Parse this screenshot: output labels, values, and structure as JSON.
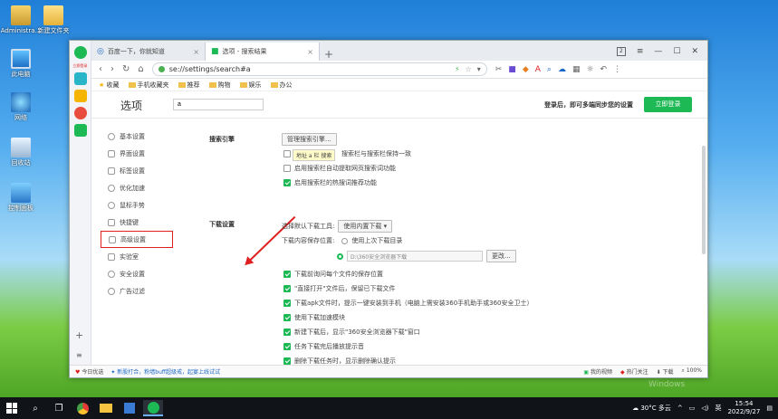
{
  "desktop": {
    "icons": [
      {
        "label": "Administra..."
      },
      {
        "label": "新建文件夹"
      },
      {
        "label": "此电脑"
      },
      {
        "label": "网络"
      },
      {
        "label": "回收站"
      },
      {
        "label": "控制面板"
      }
    ],
    "watermark": "Windows"
  },
  "browser": {
    "sidebar_label": "立即登录",
    "tabs": [
      {
        "label": "百度一下，你就知道",
        "close": "×"
      },
      {
        "label": "选项 - 搜索结果",
        "close": "×"
      }
    ],
    "new_tab": "+",
    "tab_count": "2",
    "url": "se://settings/search#a",
    "bookmarks": [
      "收藏",
      "手机收藏夹",
      "推荐",
      "购物",
      "娱乐",
      "办公"
    ]
  },
  "settings": {
    "title": "选项",
    "search_value": "a",
    "login_message": "登录后，即可多端同步您的设置",
    "login_button": "立即登录",
    "menu": [
      {
        "label": "基本设置"
      },
      {
        "label": "界面设置"
      },
      {
        "label": "标签设置"
      },
      {
        "label": "优化加速"
      },
      {
        "label": "鼠标手势"
      },
      {
        "label": "快捷键"
      },
      {
        "label": "高级设置"
      },
      {
        "label": "实验室"
      },
      {
        "label": "安全设置"
      },
      {
        "label": "广告过滤"
      }
    ],
    "search_engine": {
      "header": "搜索引擎",
      "manage_button": "管理搜索引擎...",
      "tooltip": "地址 a 栏 搜索",
      "options": [
        {
          "label": "搜索栏与搜索栏保持一致",
          "checked": false
        },
        {
          "label": "启用搜索栏自动提取网页搜索词功能",
          "checked": false
        },
        {
          "label": "启用搜索栏的热搜词推荐功能",
          "checked": true
        }
      ]
    },
    "download": {
      "header": "下载设置",
      "tool_label": "选择默认下载工具:",
      "tool_value": "使用内置下载",
      "location_label": "下载内容保存位置:",
      "last_dir": "使用上次下载目录",
      "path": "D:\\360安全浏览器下载",
      "change_button": "更改...",
      "options": [
        {
          "label": "下载前询问每个文件的保存位置",
          "checked": true
        },
        {
          "label": "\"直接打开\"文件后，保留已下载文件",
          "checked": true
        },
        {
          "label": "下载apk文件时，提示一键安装到手机（电脑上需安装360手机助手或360安全卫士）",
          "checked": true
        },
        {
          "label": "使用下载加速模块",
          "checked": true
        },
        {
          "label": "新建下载后，显示\"360安全浏览器下载\"窗口",
          "checked": true
        },
        {
          "label": "任务下载完后播放提示音",
          "checked": true
        },
        {
          "label": "删除下载任务时，显示删除确认提示",
          "checked": true
        }
      ]
    }
  },
  "statusbar": {
    "left": "今日优选",
    "news": "新股打合，粉墙buff超级戒，起宴上线试试",
    "right": [
      "我的视频",
      "热门关注",
      "下载",
      "100%"
    ]
  },
  "taskbar": {
    "weather": "30°C 多云",
    "lang": "英",
    "time": "15:54",
    "date": "2022/9/27"
  }
}
